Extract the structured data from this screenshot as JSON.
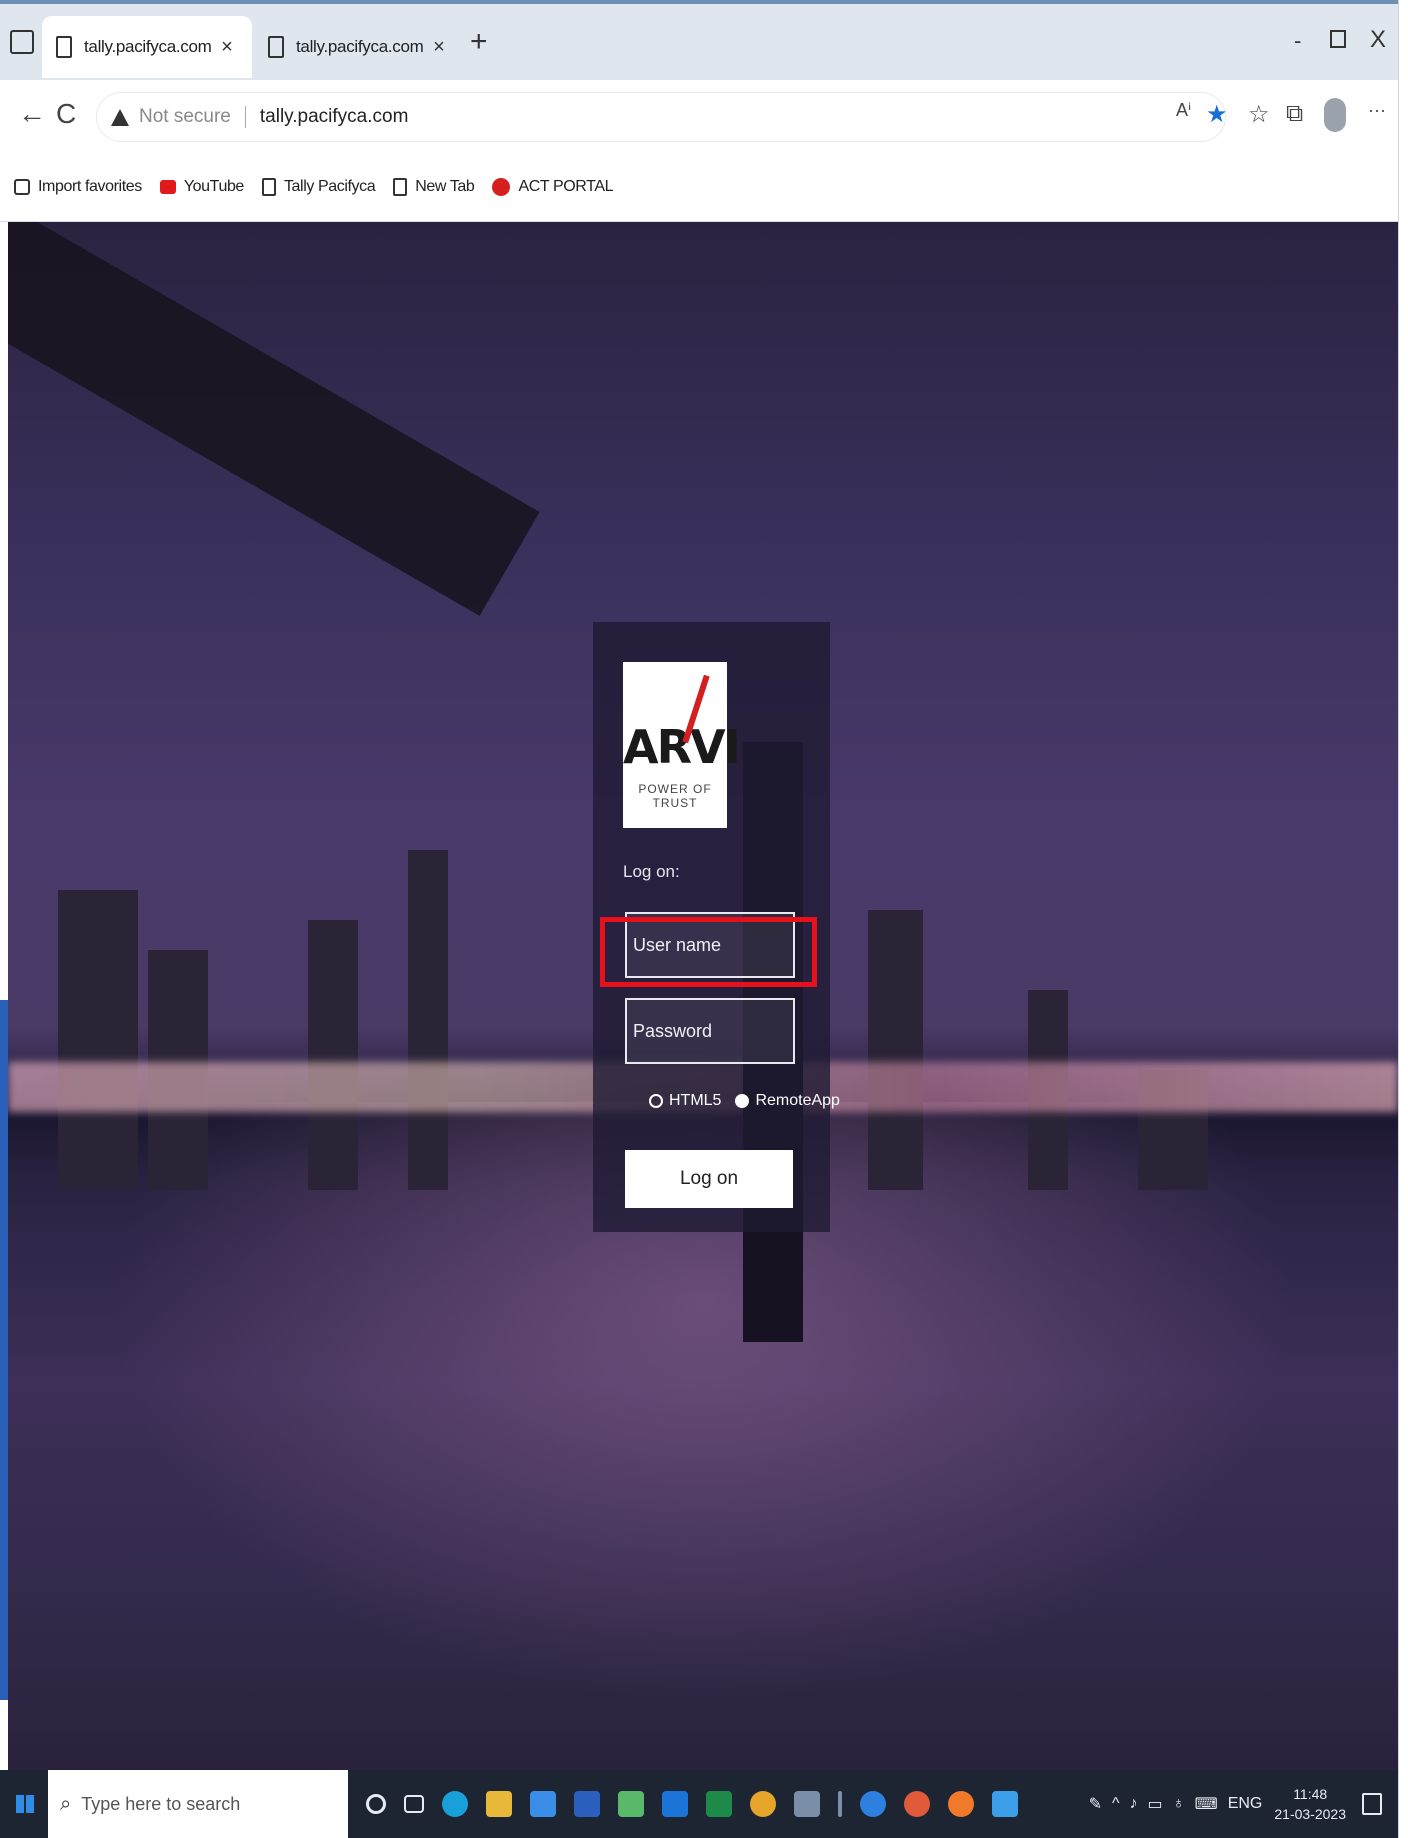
{
  "browser": {
    "tabs": [
      {
        "label": "tally.pacifyca.com",
        "active": true
      },
      {
        "label": "tally.pacifyca.com",
        "active": false
      }
    ],
    "new_tab_glyph": "+",
    "window_controls": {
      "minimize": "-",
      "close": "X"
    },
    "nav": {
      "back": "←",
      "refresh": "C"
    },
    "address": {
      "security": "Not secure",
      "url": "tally.pacifyca.com"
    },
    "toolbar_icons": [
      "read-aloud-icon",
      "favorite-star-icon",
      "favorites-icon",
      "collections-icon",
      "profile-icon",
      "more-icon"
    ],
    "more_glyph": "···",
    "read_aloud_glyph": "Aⁱ"
  },
  "bookmarks": [
    {
      "label": "Import favorites",
      "icon": "import-icon"
    },
    {
      "label": "YouTube",
      "icon": "youtube-icon"
    },
    {
      "label": "Tally Pacifyca",
      "icon": "page-icon"
    },
    {
      "label": "New Tab",
      "icon": "page-icon"
    },
    {
      "label": "ACT PORTAL",
      "icon": "act-portal-icon"
    }
  ],
  "login": {
    "logo_text": "ARVI",
    "logo_tagline": "POWER OF TRUST",
    "log_on_label": "Log on:",
    "username_placeholder": "User name",
    "password_placeholder": "Password",
    "modes": [
      {
        "label": "HTML5",
        "selected": false
      },
      {
        "label": "RemoteApp",
        "selected": true
      }
    ],
    "button_label": "Log on",
    "highlight_color": "#e8101a"
  },
  "taskbar": {
    "search_placeholder": "Type here to search",
    "apps": [
      "cortana-icon",
      "task-view-icon",
      "edge-icon",
      "file-explorer-icon",
      "calendar-icon",
      "word-icon",
      "app-icon",
      "mail-icon",
      "excel-icon",
      "chrome-icon",
      "app-icon-2",
      "separator",
      "teamviewer-icon",
      "chrome-icon-2",
      "firefox-icon",
      "photos-icon"
    ],
    "tray": {
      "language": "ENG",
      "time": "11:48",
      "date": "21-03-2023"
    }
  }
}
